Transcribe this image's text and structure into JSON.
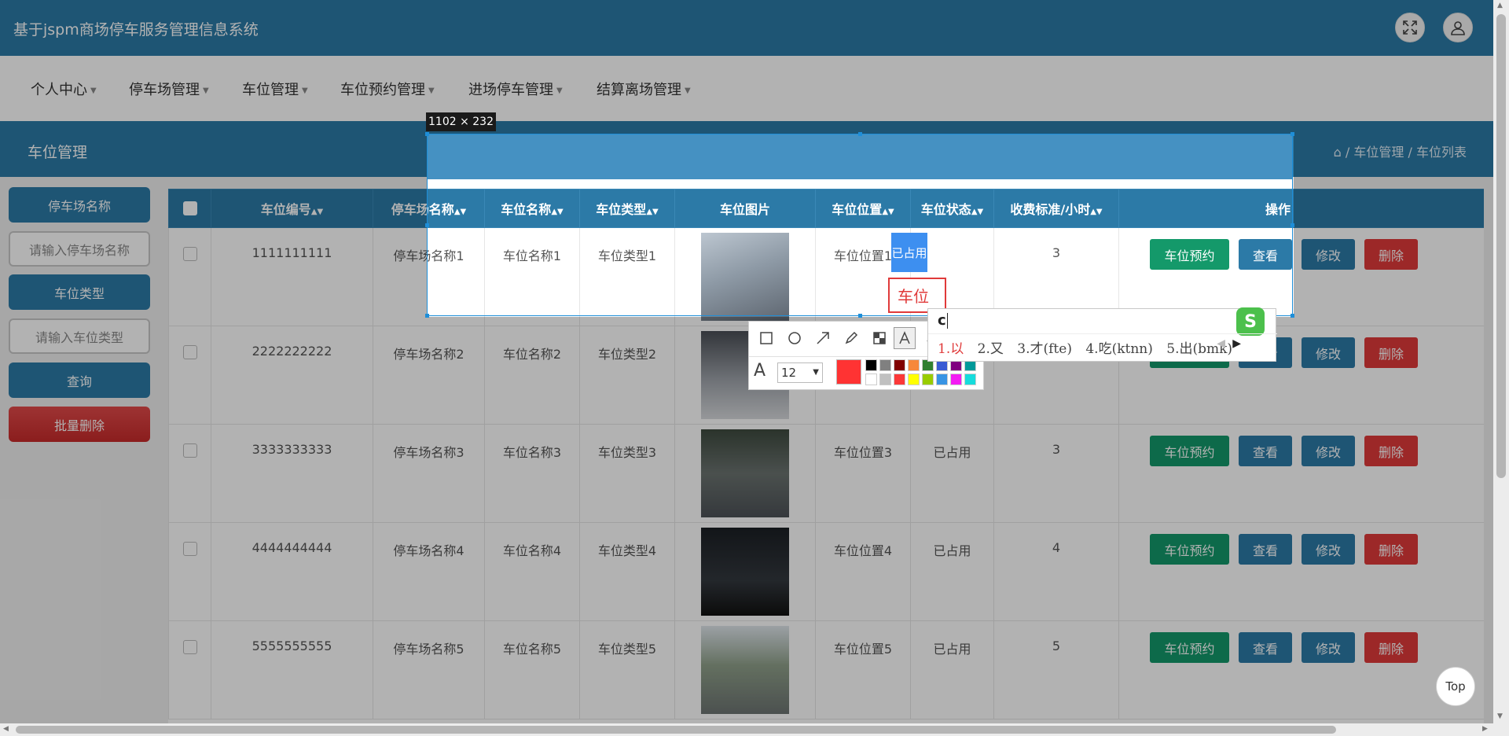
{
  "app": {
    "title": "基于jspm商场停车服务管理信息系统",
    "fullscreen_icon": "fullscreen-icon",
    "user_icon": "user-icon"
  },
  "nav": {
    "items": [
      {
        "label": "个人中心"
      },
      {
        "label": "停车场管理"
      },
      {
        "label": "车位管理"
      },
      {
        "label": "车位预约管理"
      },
      {
        "label": "进场停车管理"
      },
      {
        "label": "结算离场管理"
      }
    ]
  },
  "section": {
    "title": "车位管理",
    "breadcrumb": {
      "home_icon": "home-icon",
      "sep": "/",
      "level1": "车位管理",
      "level2": "车位列表"
    }
  },
  "sidebar": {
    "parking_name_label": "停车场名称",
    "parking_name_placeholder": "请输入停车场名称",
    "space_type_label": "车位类型",
    "space_type_placeholder": "请输入车位类型",
    "query_button": "查询",
    "batch_delete_button": "批量删除"
  },
  "table": {
    "headers": {
      "space_no": "车位编号",
      "lot_name": "停车场名称",
      "space_name": "车位名称",
      "space_type": "车位类型",
      "space_image": "车位图片",
      "space_location": "车位位置",
      "space_status": "车位状态",
      "fee": "收费标准/小时",
      "actions": "操作"
    },
    "sort_icon": "sort-icon",
    "rows": [
      {
        "space_no": "1111111111",
        "lot_name": "停车场名称1",
        "space_name": "车位名称1",
        "space_type": "车位类型1",
        "space_location": "车位位置1",
        "space_status": "已占用",
        "fee": "3"
      },
      {
        "space_no": "2222222222",
        "lot_name": "停车场名称2",
        "space_name": "车位名称2",
        "space_type": "车位类型2",
        "space_location": "",
        "space_status": "",
        "fee": ""
      },
      {
        "space_no": "3333333333",
        "lot_name": "停车场名称3",
        "space_name": "车位名称3",
        "space_type": "车位类型3",
        "space_location": "车位位置3",
        "space_status": "已占用",
        "fee": "3"
      },
      {
        "space_no": "4444444444",
        "lot_name": "停车场名称4",
        "space_name": "车位名称4",
        "space_type": "车位类型4",
        "space_location": "车位位置4",
        "space_status": "已占用",
        "fee": "4"
      },
      {
        "space_no": "5555555555",
        "lot_name": "停车场名称5",
        "space_name": "车位名称5",
        "space_type": "车位类型5",
        "space_location": "车位位置5",
        "space_status": "已占用",
        "fee": "5"
      }
    ],
    "actions": {
      "book": "车位预约",
      "view": "查看",
      "edit": "修改",
      "delete": "删除"
    }
  },
  "capture": {
    "size_label": "1102 × 232",
    "text_annotation": "车位",
    "font_size": "12",
    "current_color": "#ff3333",
    "tools": [
      "rectangle-icon",
      "ellipse-icon",
      "arrow-icon",
      "pen-icon",
      "mosaic-icon",
      "text-icon",
      "undo-icon"
    ],
    "palette": [
      "#000000",
      "#808080",
      "#800000",
      "#f7883a",
      "#308030",
      "#385ad3",
      "#800080",
      "#009999",
      "#ffffff",
      "#c0c0c0",
      "#fb3838",
      "#ffff00",
      "#99cc00",
      "#3894e4",
      "#f31bf3",
      "#16dcdc"
    ]
  },
  "ime": {
    "input": "c",
    "candidates": [
      "1.以",
      "2.又",
      "3.才(fte)",
      "4.吃(ktnn)",
      "5.出(bmk)"
    ],
    "logo": "S",
    "prev_icon": "chevron-left-icon",
    "next_icon": "chevron-right-icon"
  },
  "back_to_top": "Top"
}
